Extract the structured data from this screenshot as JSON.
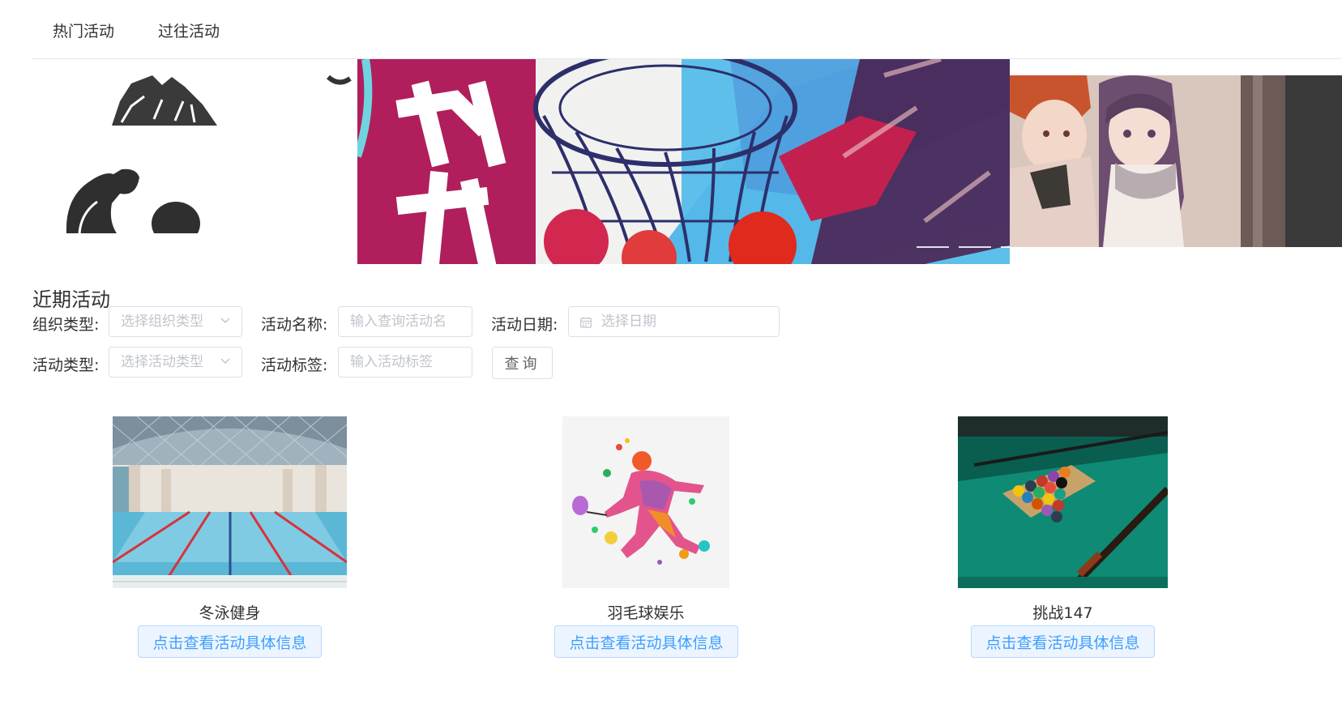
{
  "tabs": [
    {
      "label": "热门活动"
    },
    {
      "label": "过往活动"
    }
  ],
  "section_title": "近期活动",
  "filters": {
    "org_type": {
      "label": "组织类型:",
      "placeholder": "选择组织类型"
    },
    "activity_name": {
      "label": "活动名称:",
      "placeholder": "输入查询活动名"
    },
    "activity_date": {
      "label": "活动日期:",
      "placeholder": "选择日期"
    },
    "activity_type": {
      "label": "活动类型:",
      "placeholder": "选择活动类型"
    },
    "activity_tag": {
      "label": "活动标签:",
      "placeholder": "输入活动标签"
    },
    "query_button": "查询"
  },
  "cards": [
    {
      "name": "冬泳健身",
      "button": "点击查看活动具体信息",
      "image": "indoor-swimming-pool"
    },
    {
      "name": "羽毛球娱乐",
      "button": "点击查看活动具体信息",
      "image": "badminton-player-splash"
    },
    {
      "name": "挑战147",
      "button": "点击查看活动具体信息",
      "image": "billiards-table"
    }
  ],
  "carousel": {
    "slides": [
      "sports-silhouettes",
      "basketball-hoop-poster",
      "anime-couple"
    ],
    "indicator_count": 4,
    "active_index": 1
  },
  "colors": {
    "primary": "#409eff",
    "primary_light_bg": "#ecf5ff",
    "primary_border": "#b3d8ff",
    "border": "#dcdfe6",
    "placeholder": "#c0c4cc"
  }
}
